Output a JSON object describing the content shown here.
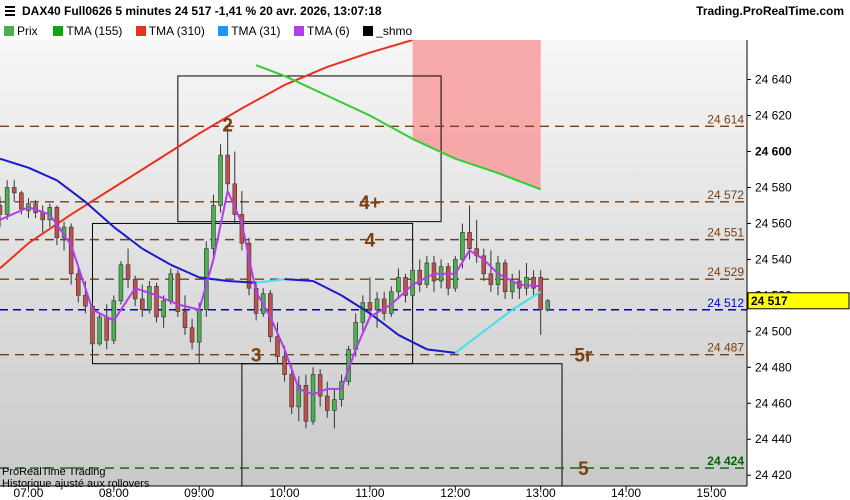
{
  "header": {
    "title": "DAX40 Full0626 5 minutes 24 517 -1,41 % 20 avr. 2026, 13:07:18",
    "brand": "Trading.ProRealTime.com"
  },
  "legend": [
    {
      "label": "Prix",
      "color": "#4caf50"
    },
    {
      "label": "TMA (155)",
      "color": "#0aa70a"
    },
    {
      "label": "TMA (310)",
      "color": "#e8321e"
    },
    {
      "label": "TMA (31)",
      "color": "#1a96ff"
    },
    {
      "label": "TMA (6)",
      "color": "#b43cf0"
    },
    {
      "label": "_shmo",
      "color": "#000000"
    }
  ],
  "footer": {
    "line1": "ProRealTime Trading",
    "line2": "Historique ajusté aux rollovers"
  },
  "colors": {
    "up": "#4caf50",
    "down": "#c0504d",
    "tma155": "#33cc33",
    "tma310": "#e8321e",
    "tma31": "#1a1acc",
    "tma31_rising": "#40e0f0",
    "tma6": "#b43cf0",
    "level": "#7a4010",
    "current": "#0000cc",
    "bottom_level": "#006400",
    "red_zone": "#f7a0a0"
  },
  "chart_data": {
    "type": "candlestick",
    "instrument": "DAX40 Full0626",
    "timeframe": "5 minutes",
    "last_price": 24517,
    "ylim": [
      24414,
      24662
    ],
    "y_ticks": [
      "24 420",
      "24 440",
      "24 460",
      "24 480",
      "24 500",
      "24 520",
      "24 540",
      "24 560",
      "24 580",
      "24 600",
      "24 620",
      "24 640"
    ],
    "x_ticks": [
      "07:00",
      "08:00",
      "09:00",
      "10:00",
      "11:00",
      "12:00",
      "13:00",
      "14:00",
      "15:00"
    ],
    "x_start": "06:40",
    "x_end": "15:25",
    "candles": [
      {
        "t": "06:40",
        "o": 24570,
        "h": 24575,
        "l": 24558,
        "c": 24565
      },
      {
        "t": "06:45",
        "o": 24565,
        "h": 24584,
        "l": 24562,
        "c": 24580
      },
      {
        "t": "06:50",
        "o": 24580,
        "h": 24584,
        "l": 24572,
        "c": 24577
      },
      {
        "t": "06:55",
        "o": 24577,
        "h": 24578,
        "l": 24565,
        "c": 24568
      },
      {
        "t": "07:00",
        "o": 24567,
        "h": 24574,
        "l": 24563,
        "c": 24571
      },
      {
        "t": "07:05",
        "o": 24571,
        "h": 24573,
        "l": 24563,
        "c": 24566
      },
      {
        "t": "07:10",
        "o": 24566,
        "h": 24570,
        "l": 24555,
        "c": 24562
      },
      {
        "t": "07:15",
        "o": 24562,
        "h": 24571,
        "l": 24558,
        "c": 24569
      },
      {
        "t": "07:20",
        "o": 24569,
        "h": 24570,
        "l": 24548,
        "c": 24552
      },
      {
        "t": "07:25",
        "o": 24552,
        "h": 24561,
        "l": 24545,
        "c": 24558
      },
      {
        "t": "07:30",
        "o": 24558,
        "h": 24560,
        "l": 24526,
        "c": 24532
      },
      {
        "t": "07:35",
        "o": 24532,
        "h": 24535,
        "l": 24516,
        "c": 24520
      },
      {
        "t": "07:40",
        "o": 24520,
        "h": 24528,
        "l": 24510,
        "c": 24514
      },
      {
        "t": "07:45",
        "o": 24514,
        "h": 24516,
        "l": 24490,
        "c": 24493
      },
      {
        "t": "07:50",
        "o": 24493,
        "h": 24510,
        "l": 24492,
        "c": 24508
      },
      {
        "t": "07:55",
        "o": 24508,
        "h": 24515,
        "l": 24490,
        "c": 24495
      },
      {
        "t": "08:00",
        "o": 24495,
        "h": 24520,
        "l": 24493,
        "c": 24517
      },
      {
        "t": "08:05",
        "o": 24517,
        "h": 24539,
        "l": 24515,
        "c": 24537
      },
      {
        "t": "08:10",
        "o": 24537,
        "h": 24546,
        "l": 24524,
        "c": 24529
      },
      {
        "t": "08:15",
        "o": 24529,
        "h": 24531,
        "l": 24514,
        "c": 24518
      },
      {
        "t": "08:20",
        "o": 24518,
        "h": 24526,
        "l": 24508,
        "c": 24512
      },
      {
        "t": "08:25",
        "o": 24512,
        "h": 24528,
        "l": 24510,
        "c": 24525
      },
      {
        "t": "08:30",
        "o": 24525,
        "h": 24527,
        "l": 24505,
        "c": 24508
      },
      {
        "t": "08:35",
        "o": 24508,
        "h": 24520,
        "l": 24502,
        "c": 24517
      },
      {
        "t": "08:40",
        "o": 24517,
        "h": 24535,
        "l": 24515,
        "c": 24532
      },
      {
        "t": "08:45",
        "o": 24532,
        "h": 24534,
        "l": 24508,
        "c": 24511
      },
      {
        "t": "08:50",
        "o": 24511,
        "h": 24520,
        "l": 24498,
        "c": 24502
      },
      {
        "t": "08:55",
        "o": 24502,
        "h": 24507,
        "l": 24490,
        "c": 24494
      },
      {
        "t": "09:00",
        "o": 24494,
        "h": 24516,
        "l": 24482,
        "c": 24512
      },
      {
        "t": "09:05",
        "o": 24512,
        "h": 24550,
        "l": 24508,
        "c": 24546
      },
      {
        "t": "09:10",
        "o": 24546,
        "h": 24576,
        "l": 24540,
        "c": 24570
      },
      {
        "t": "09:15",
        "o": 24570,
        "h": 24604,
        "l": 24566,
        "c": 24598
      },
      {
        "t": "09:20",
        "o": 24598,
        "h": 24614,
        "l": 24576,
        "c": 24582
      },
      {
        "t": "09:25",
        "o": 24582,
        "h": 24600,
        "l": 24560,
        "c": 24565
      },
      {
        "t": "09:30",
        "o": 24565,
        "h": 24578,
        "l": 24545,
        "c": 24549
      },
      {
        "t": "09:35",
        "o": 24549,
        "h": 24552,
        "l": 24520,
        "c": 24524
      },
      {
        "t": "09:40",
        "o": 24524,
        "h": 24528,
        "l": 24506,
        "c": 24510
      },
      {
        "t": "09:45",
        "o": 24510,
        "h": 24524,
        "l": 24508,
        "c": 24521
      },
      {
        "t": "09:50",
        "o": 24521,
        "h": 24523,
        "l": 24494,
        "c": 24497
      },
      {
        "t": "09:55",
        "o": 24497,
        "h": 24505,
        "l": 24482,
        "c": 24486
      },
      {
        "t": "10:00",
        "o": 24486,
        "h": 24492,
        "l": 24472,
        "c": 24476
      },
      {
        "t": "10:05",
        "o": 24476,
        "h": 24481,
        "l": 24454,
        "c": 24458
      },
      {
        "t": "10:10",
        "o": 24458,
        "h": 24475,
        "l": 24450,
        "c": 24470
      },
      {
        "t": "10:15",
        "o": 24470,
        "h": 24476,
        "l": 24446,
        "c": 24450
      },
      {
        "t": "10:20",
        "o": 24450,
        "h": 24480,
        "l": 24448,
        "c": 24476
      },
      {
        "t": "10:25",
        "o": 24476,
        "h": 24479,
        "l": 24458,
        "c": 24464
      },
      {
        "t": "10:30",
        "o": 24464,
        "h": 24472,
        "l": 24452,
        "c": 24456
      },
      {
        "t": "10:35",
        "o": 24456,
        "h": 24468,
        "l": 24446,
        "c": 24462
      },
      {
        "t": "10:40",
        "o": 24462,
        "h": 24476,
        "l": 24458,
        "c": 24472
      },
      {
        "t": "10:45",
        "o": 24472,
        "h": 24492,
        "l": 24470,
        "c": 24490
      },
      {
        "t": "10:50",
        "o": 24490,
        "h": 24510,
        "l": 24486,
        "c": 24505
      },
      {
        "t": "10:55",
        "o": 24505,
        "h": 24520,
        "l": 24500,
        "c": 24516
      },
      {
        "t": "11:00",
        "o": 24516,
        "h": 24530,
        "l": 24508,
        "c": 24512
      },
      {
        "t": "11:05",
        "o": 24512,
        "h": 24522,
        "l": 24502,
        "c": 24518
      },
      {
        "t": "11:10",
        "o": 24518,
        "h": 24522,
        "l": 24506,
        "c": 24510
      },
      {
        "t": "11:15",
        "o": 24510,
        "h": 24525,
        "l": 24508,
        "c": 24522
      },
      {
        "t": "11:20",
        "o": 24522,
        "h": 24535,
        "l": 24518,
        "c": 24530
      },
      {
        "t": "11:25",
        "o": 24530,
        "h": 24532,
        "l": 24516,
        "c": 24520
      },
      {
        "t": "11:30",
        "o": 24520,
        "h": 24538,
        "l": 24518,
        "c": 24534
      },
      {
        "t": "11:35",
        "o": 24534,
        "h": 24540,
        "l": 24522,
        "c": 24526
      },
      {
        "t": "11:40",
        "o": 24526,
        "h": 24542,
        "l": 24524,
        "c": 24538
      },
      {
        "t": "11:45",
        "o": 24538,
        "h": 24542,
        "l": 24522,
        "c": 24528
      },
      {
        "t": "11:50",
        "o": 24528,
        "h": 24540,
        "l": 24524,
        "c": 24536
      },
      {
        "t": "11:55",
        "o": 24536,
        "h": 24538,
        "l": 24520,
        "c": 24524
      },
      {
        "t": "12:00",
        "o": 24524,
        "h": 24542,
        "l": 24522,
        "c": 24540
      },
      {
        "t": "12:05",
        "o": 24540,
        "h": 24560,
        "l": 24535,
        "c": 24555
      },
      {
        "t": "12:10",
        "o": 24555,
        "h": 24570,
        "l": 24540,
        "c": 24546
      },
      {
        "t": "12:15",
        "o": 24546,
        "h": 24562,
        "l": 24538,
        "c": 24542
      },
      {
        "t": "12:20",
        "o": 24542,
        "h": 24546,
        "l": 24528,
        "c": 24532
      },
      {
        "t": "12:25",
        "o": 24532,
        "h": 24545,
        "l": 24522,
        "c": 24526
      },
      {
        "t": "12:30",
        "o": 24526,
        "h": 24542,
        "l": 24520,
        "c": 24538
      },
      {
        "t": "12:35",
        "o": 24538,
        "h": 24540,
        "l": 24518,
        "c": 24522
      },
      {
        "t": "12:40",
        "o": 24522,
        "h": 24532,
        "l": 24518,
        "c": 24528
      },
      {
        "t": "12:45",
        "o": 24528,
        "h": 24534,
        "l": 24518,
        "c": 24524
      },
      {
        "t": "12:50",
        "o": 24524,
        "h": 24538,
        "l": 24520,
        "c": 24530
      },
      {
        "t": "12:55",
        "o": 24530,
        "h": 24534,
        "l": 24520,
        "c": 24524
      },
      {
        "t": "13:00",
        "o": 24530,
        "h": 24534,
        "l": 24498,
        "c": 24512
      },
      {
        "t": "13:05",
        "o": 24512,
        "h": 24518,
        "l": 24511,
        "c": 24517
      }
    ],
    "tma_155": [
      [
        "09:40",
        24648
      ],
      [
        "10:00",
        24642
      ],
      [
        "10:30",
        24631
      ],
      [
        "11:00",
        24620
      ],
      [
        "11:30",
        24607
      ],
      [
        "12:00",
        24596
      ],
      [
        "12:30",
        24588
      ],
      [
        "13:00",
        24579
      ]
    ],
    "tma_310": [
      [
        "06:40",
        24535
      ],
      [
        "07:00",
        24549
      ],
      [
        "07:30",
        24565
      ],
      [
        "08:00",
        24580
      ],
      [
        "08:30",
        24595
      ],
      [
        "09:00",
        24610
      ],
      [
        "09:30",
        24624
      ],
      [
        "10:00",
        24637
      ],
      [
        "10:30",
        24647
      ],
      [
        "11:00",
        24655
      ],
      [
        "11:30",
        24662
      ]
    ],
    "tma_31": [
      [
        "06:40",
        24596
      ],
      [
        "07:00",
        24591
      ],
      [
        "07:20",
        24584
      ],
      [
        "07:40",
        24572
      ],
      [
        "08:00",
        24558
      ],
      [
        "08:20",
        24546
      ],
      [
        "08:40",
        24537
      ],
      [
        "09:00",
        24530
      ],
      [
        "09:20",
        24528
      ],
      [
        "09:40",
        24527
      ],
      [
        "10:00",
        24529
      ],
      [
        "10:20",
        24528
      ],
      [
        "10:40",
        24520
      ],
      [
        "11:00",
        24510
      ],
      [
        "11:20",
        24498
      ],
      [
        "11:40",
        24490
      ],
      [
        "12:00",
        24488
      ],
      [
        "12:20",
        24500
      ],
      [
        "12:40",
        24512
      ],
      [
        "13:00",
        24522
      ]
    ],
    "tma_6": [
      [
        "06:40",
        24562
      ],
      [
        "07:00",
        24569
      ],
      [
        "07:15",
        24565
      ],
      [
        "07:30",
        24548
      ],
      [
        "07:45",
        24512
      ],
      [
        "08:00",
        24506
      ],
      [
        "08:15",
        24524
      ],
      [
        "08:30",
        24520
      ],
      [
        "08:45",
        24515
      ],
      [
        "09:00",
        24512
      ],
      [
        "09:10",
        24540
      ],
      [
        "09:20",
        24578
      ],
      [
        "09:30",
        24560
      ],
      [
        "09:40",
        24522
      ],
      [
        "09:50",
        24508
      ],
      [
        "10:00",
        24490
      ],
      [
        "10:10",
        24468
      ],
      [
        "10:20",
        24465
      ],
      [
        "10:30",
        24468
      ],
      [
        "10:40",
        24468
      ],
      [
        "10:50",
        24490
      ],
      [
        "11:00",
        24508
      ],
      [
        "11:15",
        24515
      ],
      [
        "11:30",
        24526
      ],
      [
        "11:45",
        24532
      ],
      [
        "12:00",
        24532
      ],
      [
        "12:10",
        24545
      ],
      [
        "12:20",
        24540
      ],
      [
        "12:30",
        24532
      ],
      [
        "12:45",
        24526
      ],
      [
        "13:00",
        24525
      ]
    ],
    "levels": [
      {
        "price": 24614,
        "label": "24 614",
        "style": "brown"
      },
      {
        "price": 24572,
        "label": "24 572",
        "style": "brown"
      },
      {
        "price": 24551,
        "label": "24 551",
        "style": "brown"
      },
      {
        "price": 24529,
        "label": "24 529",
        "style": "brown"
      },
      {
        "price": 24512,
        "label": "24 512",
        "style": "blue"
      },
      {
        "price": 24487,
        "label": "24 487",
        "style": "brown"
      },
      {
        "price": 24424,
        "label": "24 424",
        "style": "green"
      }
    ],
    "zone_labels": [
      {
        "text": "2",
        "t": "09:20",
        "price": 24615
      },
      {
        "text": "4+",
        "t": "11:00",
        "price": 24572
      },
      {
        "text": "4",
        "t": "11:00",
        "price": 24551
      },
      {
        "text": "3",
        "t": "09:40",
        "price": 24487
      },
      {
        "text": "5r",
        "t": "13:30",
        "price": 24487
      },
      {
        "text": "5",
        "t": "13:30",
        "price": 24424
      }
    ],
    "boxes": [
      {
        "t1": "08:45",
        "t2": "11:50",
        "p_top": 24642,
        "p_bottom": 24561
      },
      {
        "t1": "07:45",
        "t2": "11:30",
        "p_top": 24560,
        "p_bottom": 24482
      },
      {
        "t1": "09:30",
        "t2": "13:15",
        "p_top": 24482,
        "p_bottom": 24414
      }
    ],
    "red_zone": {
      "t1": "11:30",
      "t2": "13:00",
      "p_top": 24662,
      "p_bottom": 24579
    }
  }
}
